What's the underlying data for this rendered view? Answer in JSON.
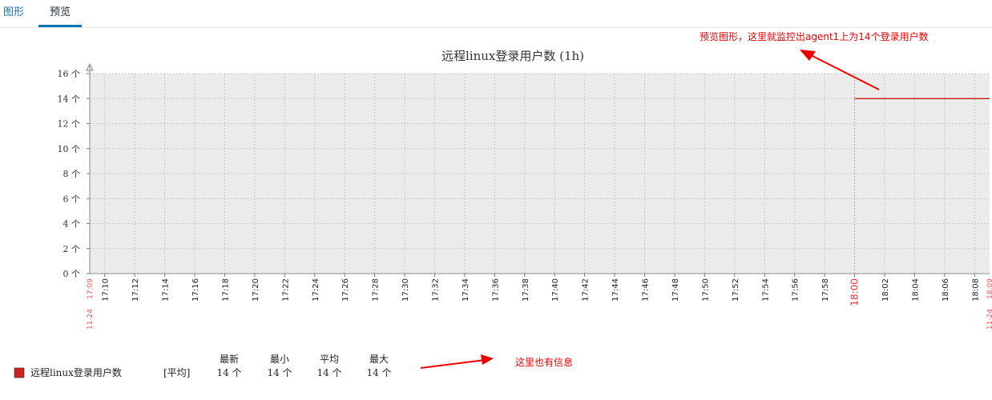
{
  "tabs": [
    {
      "label": "图形",
      "active": false
    },
    {
      "label": "预览",
      "active": true
    }
  ],
  "chart_data": {
    "type": "line",
    "title": "远程linux登录用户数 (1h)",
    "y_unit": "个",
    "ylim": [
      0,
      16
    ],
    "y_ticks": [
      "0 个",
      "2 个",
      "4 个",
      "6 个",
      "8 个",
      "10 个",
      "12 个",
      "14 个",
      "16 个"
    ],
    "x_ticks": [
      "17:10",
      "17:12",
      "17:14",
      "17:16",
      "17:18",
      "17:20",
      "17:22",
      "17:24",
      "17:26",
      "17:28",
      "17:30",
      "17:32",
      "17:34",
      "17:36",
      "17:38",
      "17:40",
      "17:42",
      "17:44",
      "17:46",
      "17:48",
      "17:50",
      "17:52",
      "17:54",
      "17:56",
      "17:58",
      "18:00",
      "18:02",
      "18:04",
      "18:06",
      "18:08"
    ],
    "x_start_label": "17:09",
    "x_start_date": "11-24",
    "x_end_label": "18:09",
    "x_end_date": "11-24",
    "grid": true,
    "series": [
      {
        "name": "远程linux登录用户数",
        "color": "#c80000",
        "points": [
          [
            "18:00",
            14
          ],
          [
            "18:09",
            14
          ]
        ]
      }
    ],
    "legend": {
      "label": "远程linux登录用户数",
      "func": "[平均]",
      "headers": [
        "最新",
        "最小",
        "平均",
        "最大"
      ],
      "values": [
        "14 个",
        "14 个",
        "14 个",
        "14 个"
      ],
      "color": "#cc2222"
    }
  },
  "annotations": {
    "top": "预览图形，这里就监控出agent1上为14个登录用户数",
    "bottom": "这里也有信息"
  }
}
